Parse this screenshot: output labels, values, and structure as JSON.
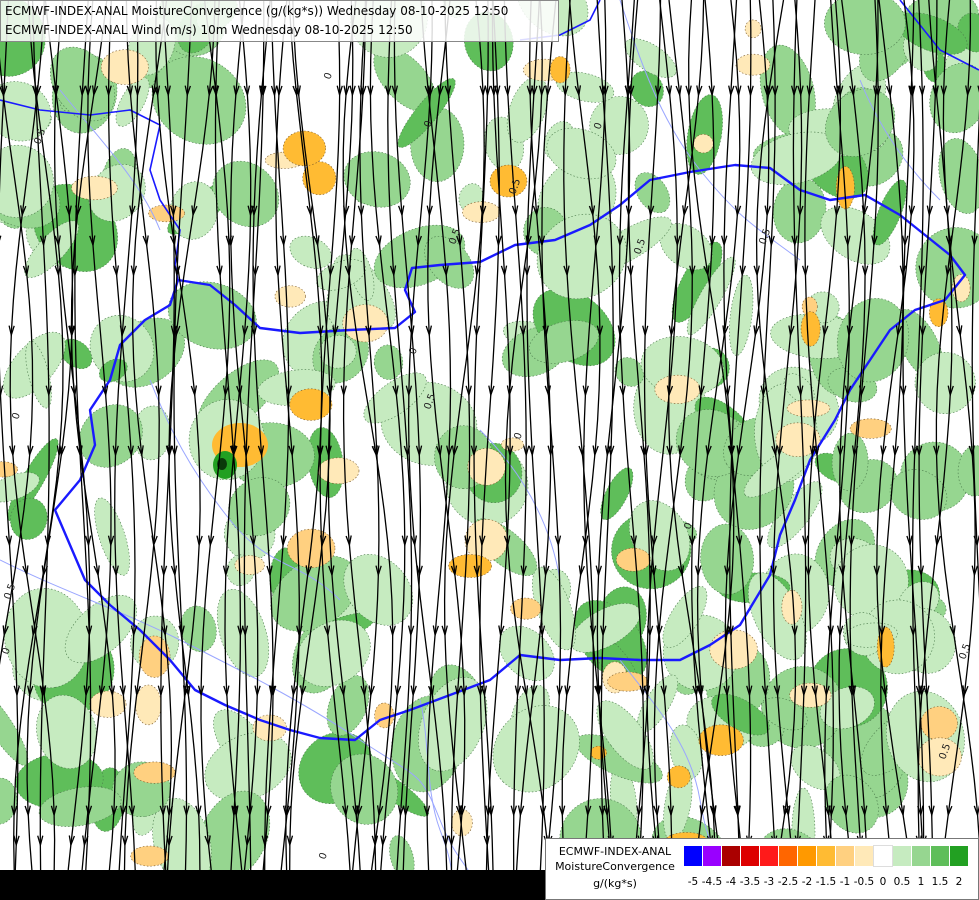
{
  "title": {
    "line1": "ECMWF-INDEX-ANAL MoistureConvergence (g/(kg*s)) Wednesday 08-10-2025 12:50",
    "line2": "ECMWF-INDEX-ANAL Wind (m/s) 10m Wednesday 08-10-2025 12:50"
  },
  "contour_labels": [
    "0",
    "0.5",
    "-0.5"
  ],
  "legend": {
    "line1": "ECMWF-INDEX-ANAL",
    "line2": "MoistureConvergence",
    "line3": "g/(kg*s)",
    "ticks": [
      "-5",
      "-4.5",
      "-4",
      "-3.5",
      "-3",
      "-2.5",
      "-2",
      "-1.5",
      "-1",
      "-0.5",
      "0",
      "0.5",
      "1",
      "1.5",
      "2"
    ],
    "colors": [
      "#0000ff",
      "#9900ff",
      "#aa0000",
      "#dd0000",
      "#ff1a1a",
      "#ff6600",
      "#ff9900",
      "#ffbb33",
      "#ffd080",
      "#ffe9b8",
      "#ffffff",
      "#c6ebc0",
      "#96d690",
      "#5fbe5a",
      "#22a022"
    ]
  },
  "colors": {
    "border": "#1a1aff",
    "rivers": "#9aa6ff",
    "streamline": "#000000"
  }
}
